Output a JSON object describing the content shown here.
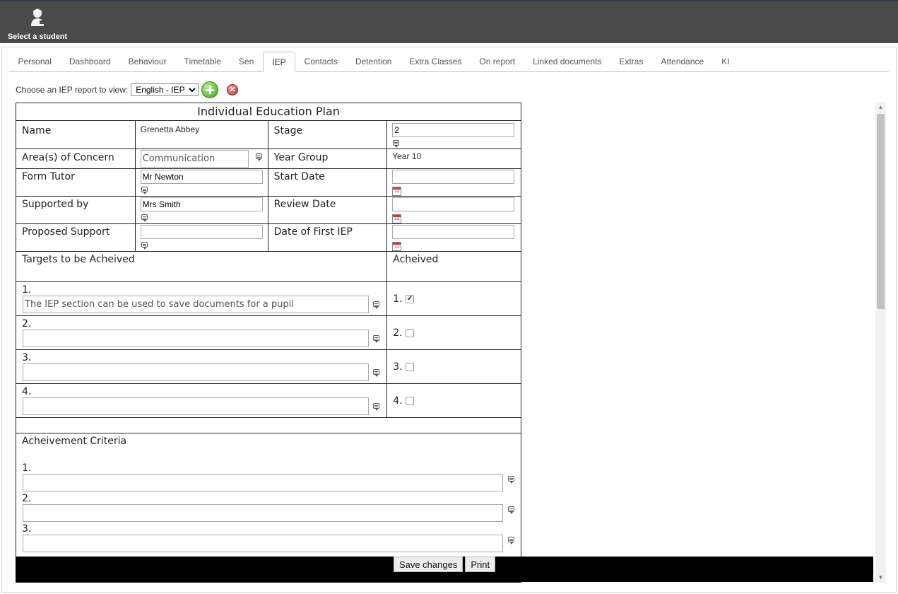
{
  "topbar": {
    "select_student_label": "Select a student"
  },
  "tabs": [
    "Personal",
    "Dashboard",
    "Behaviour",
    "Timetable",
    "Sen",
    "IEP",
    "Contacts",
    "Detention",
    "Extra Classes",
    "On report",
    "Linked documents",
    "Extras",
    "Attendance",
    "KI"
  ],
  "active_tab": "IEP",
  "chooser": {
    "label": "Choose an IEP report to view:",
    "selected": "English - IEP"
  },
  "iep": {
    "title": "Individual Education Plan",
    "name_label": "Name",
    "name_value": "Grenetta Abbey",
    "stage_label": "Stage",
    "stage_value": "2",
    "area_label": "Area(s) of Concern",
    "area_value": "Communication",
    "year_group_label": "Year Group",
    "year_group_value": "Year 10",
    "form_tutor_label": "Form Tutor",
    "form_tutor_value": "Mr Newton",
    "start_date_label": "Start Date",
    "start_date_value": "",
    "supported_by_label": "Supported by",
    "supported_by_value": "Mrs Smith",
    "review_date_label": "Review Date",
    "review_date_value": "",
    "proposed_support_label": "Proposed Support",
    "proposed_support_value": "",
    "first_iep_label": "Date of First IEP",
    "first_iep_value": "",
    "targets_label": "Targets to be Acheived",
    "achieved_label": "Acheived",
    "targets": [
      {
        "num": "1.",
        "value": "The IEP section can be used to save documents for a pupil",
        "achieved": true
      },
      {
        "num": "2.",
        "value": "",
        "achieved": false
      },
      {
        "num": "3.",
        "value": "",
        "achieved": false
      },
      {
        "num": "4.",
        "value": "",
        "achieved": false
      }
    ],
    "criteria_label": "Acheivement Criteria",
    "criteria": [
      {
        "num": "1.",
        "value": ""
      },
      {
        "num": "2.",
        "value": ""
      },
      {
        "num": "3.",
        "value": ""
      }
    ]
  },
  "buttons": {
    "save": "Save changes",
    "print": "Print"
  },
  "calendar_icon_text": "12"
}
